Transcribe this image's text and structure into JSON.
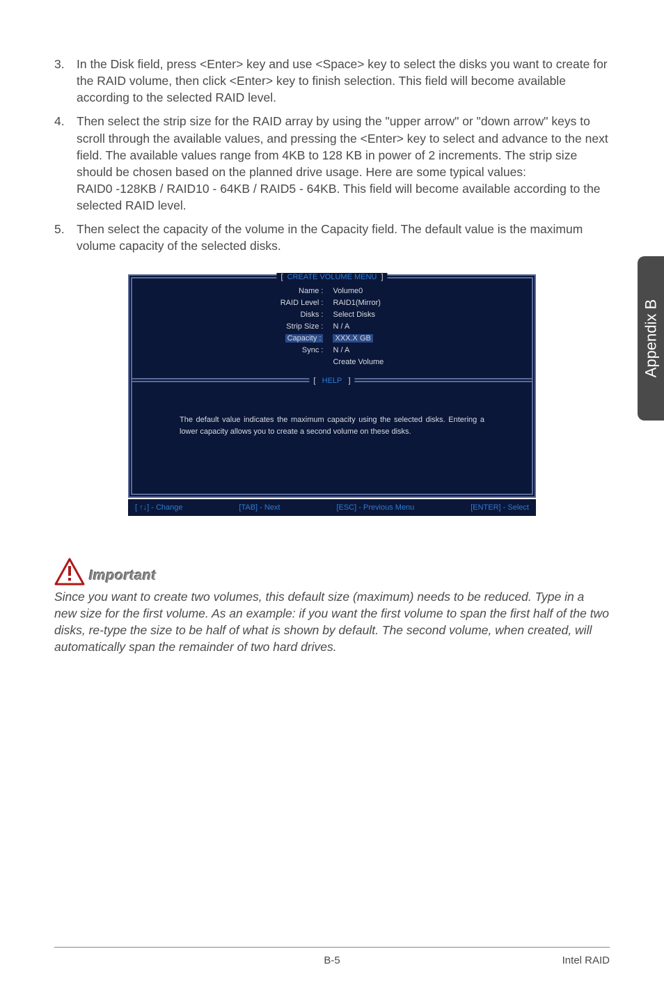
{
  "steps": [
    {
      "num": "3.",
      "text": "In the Disk field, press <Enter> key and use <Space> key to select the disks you want to create for the RAID volume, then click <Enter> key to finish selection. This field will become available according to the selected RAID level."
    },
    {
      "num": "4.",
      "text": "Then select the strip size for the RAID array by using the \"upper arrow\" or \"down arrow\" keys to scroll through the available values, and pressing the <Enter> key to select and advance to the next field. The available values range from 4KB to 128 KB in power of 2 increments. The strip size should be chosen based on the planned drive usage. Here are some typical values:\nRAID0 -128KB / RAID10 - 64KB / RAID5 - 64KB. This field will become available according to the selected RAID level."
    },
    {
      "num": "5.",
      "text": "Then select the capacity of the volume in the Capacity field. The default value is the maximum volume capacity of the selected disks."
    }
  ],
  "bios": {
    "create_title": "CREATE VOLUME MENU",
    "help_title": "HELP",
    "fields": {
      "name_label": "Name :",
      "name_value": "Volume0",
      "raid_label": "RAID Level :",
      "raid_value": "RAID1(Mirror)",
      "disks_label": "Disks :",
      "disks_value": "Select  Disks",
      "strip_label": "Strip Size :",
      "strip_value": "N / A",
      "capacity_label": "Capacity :",
      "capacity_value": "XXX.X  GB",
      "sync_label": "Sync :",
      "sync_value": "N / A",
      "create_label": "Create Volume"
    },
    "help_text": "The default value indicates the maximum capacity using the selected disks. Entering a lower capacity allows you to create a second volume on these disks.",
    "footer": {
      "change": "[ ↑↓] - Change",
      "tab": "[TAB] - Next",
      "esc": "[ESC] - Previous Menu",
      "enter": "[ENTER] - Select"
    }
  },
  "important": {
    "label": "Important",
    "text": "Since you want to create two volumes, this default size (maximum) needs to be reduced. Type in a new size for the first volume. As an example: if you want the first volume to span the first half of the two disks, re-type the size to be half of what is shown by default. The second volume, when created, will automatically span the remainder of two hard drives."
  },
  "side_tab": "Appendix B",
  "page_footer": {
    "left": "",
    "center": "B-5",
    "right": "Intel RAID"
  }
}
